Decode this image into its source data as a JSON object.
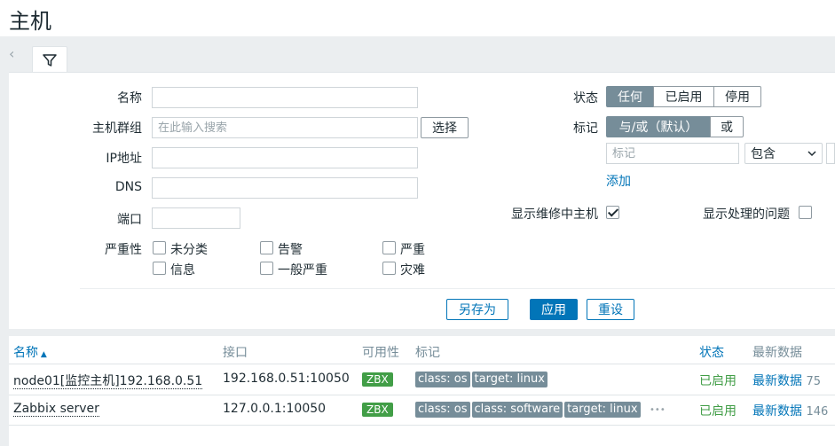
{
  "page": {
    "title": "主机"
  },
  "filter": {
    "labels": {
      "name": "名称",
      "host_group": "主机群组",
      "ip": "IP地址",
      "dns": "DNS",
      "port": "端口",
      "severity": "严重性",
      "status": "状态",
      "tags": "标记",
      "show_maintenance": "显示维修中主机",
      "show_suppressed": "显示处理的问题"
    },
    "values": {
      "name": "",
      "host_group": "",
      "ip": "",
      "dns": "",
      "port": ""
    },
    "placeholders": {
      "host_group": "在此输入搜索",
      "tag": "标记"
    },
    "select_button": "选择",
    "status_options": [
      "任何",
      "已启用",
      "停用"
    ],
    "tag_operator_options": [
      "与/或（默认）",
      "或"
    ],
    "tag_condition": "包含",
    "add_link": "添加",
    "severities": [
      "未分类",
      "告警",
      "严重",
      "信息",
      "一般严重",
      "灾难"
    ],
    "buttons": {
      "save_as": "另存为",
      "apply": "应用",
      "reset": "重设"
    }
  },
  "table": {
    "headers": {
      "name": "名称",
      "interface": "接口",
      "availability": "可用性",
      "tags": "标记",
      "status": "状态",
      "latest": "最新数据"
    },
    "rows": [
      {
        "name": "node01[监控主机]192.168.0.51",
        "interface": "192.168.0.51:10050",
        "availability": "ZBX",
        "tags": [
          "class: os",
          "target: linux"
        ],
        "status": "已启用",
        "latest": "最新数据",
        "count": "75"
      },
      {
        "name": "Zabbix server",
        "interface": "127.0.0.1:10050",
        "availability": "ZBX",
        "tags": [
          "class: os",
          "class: software",
          "target: linux"
        ],
        "more": "•••",
        "status": "已启用",
        "latest": "最新数据",
        "count": "146"
      }
    ]
  },
  "colors": {
    "accent": "#0275b8",
    "active_segment": "#768d99",
    "available": "#429e47"
  }
}
